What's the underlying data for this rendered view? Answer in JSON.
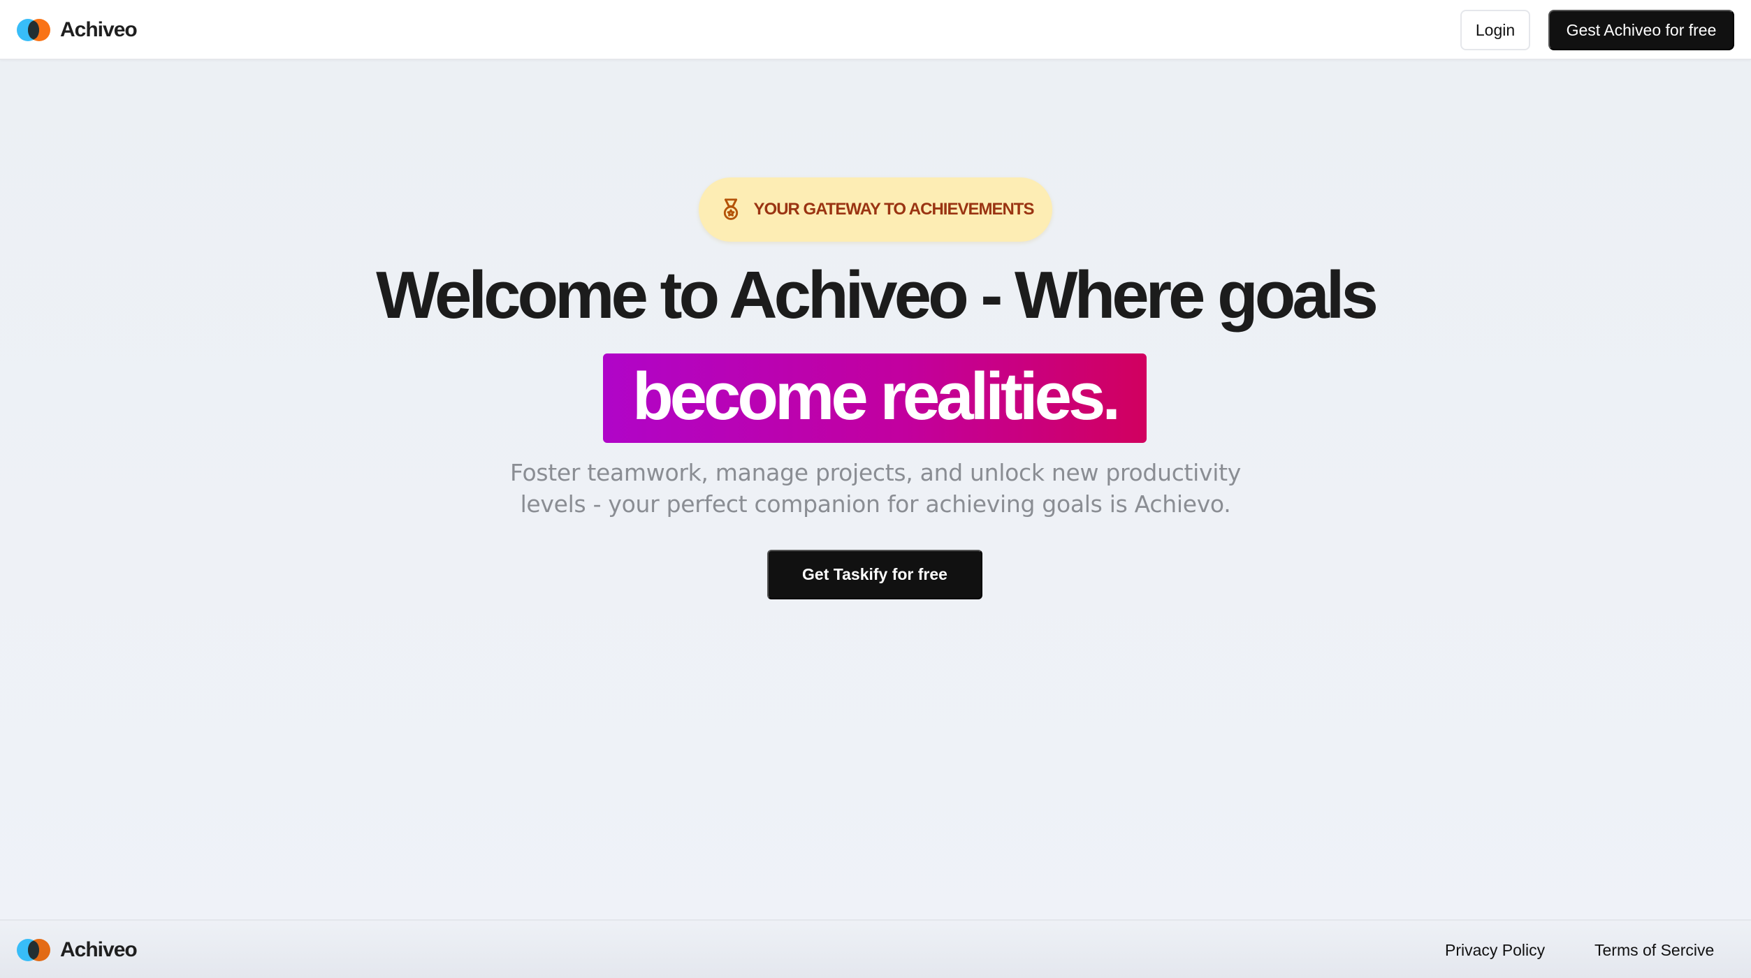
{
  "header": {
    "brand_name": "Achiveo",
    "login_label": "Login",
    "cta_label": "Gest Achiveo for free"
  },
  "hero": {
    "badge_icon": "medal-icon",
    "badge_text": "YOUR GATEWAY TO ACHIEVEMENTS",
    "headline": "Welcome to Achiveo - Where goals",
    "highlight": "become realities.",
    "subtitle_line1": "Foster teamwork, manage projects, and unlock new productivity",
    "subtitle_line2": "levels - your perfect companion for achieving goals is Achievo.",
    "cta_label": "Get Taskify for free"
  },
  "footer": {
    "brand_name": "Achiveo",
    "privacy_label": "Privacy Policy",
    "terms_label": "Terms of Sercive"
  },
  "colors": {
    "background": "#edf1f5",
    "primary_button": "#111111",
    "badge_bg": "#fdedb4",
    "badge_text": "#9a3412",
    "highlight_from": "#b005c8",
    "highlight_to": "#d1005f",
    "logo_blue": "#38bdf8",
    "logo_orange": "#f97316"
  }
}
